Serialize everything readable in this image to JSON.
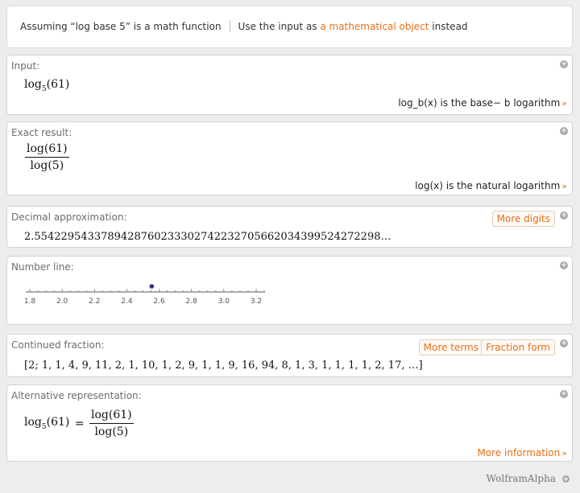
{
  "assumption": {
    "prefix": "Assuming “log base 5” is a math function",
    "alt_prefix": "Use the input as ",
    "alt_link": "a mathematical object",
    "alt_suffix": " instead"
  },
  "pods": {
    "input": {
      "title": "Input:",
      "expr_fn": "log",
      "expr_sub": "5",
      "expr_arg": "(61)",
      "note": "log_b(x) is the base− b logarithm",
      "note_arrow": "»"
    },
    "exact": {
      "title": "Exact result:",
      "numerator": "log(61)",
      "denominator": "log(5)",
      "note": "log(x) is the natural logarithm",
      "note_arrow": "»"
    },
    "decimal": {
      "title": "Decimal approximation:",
      "button": "More digits",
      "value": "2.5542295433789428760233302742232705662034399524272298…"
    },
    "numberline": {
      "title": "Number line:",
      "ticks": [
        "1.8",
        "2.0",
        "2.2",
        "2.4",
        "2.6",
        "2.8",
        "3.0",
        "3.2"
      ],
      "point_value": 2.554,
      "axis_min": 1.8,
      "axis_max": 3.2,
      "point_color": "#2e3192"
    },
    "continued": {
      "title": "Continued fraction:",
      "button_terms": "More terms",
      "button_fraction": "Fraction form",
      "value": "[2; 1, 1, 4, 9, 11, 2, 1, 10, 1, 2, 9, 1, 1, 9, 16, 94, 8, 1, 3, 1, 1, 1, 1, 2, 17, …]"
    },
    "alternative": {
      "title": "Alternative representation:",
      "lhs_fn": "log",
      "lhs_sub": "5",
      "lhs_arg": "(61)",
      "equals": "=",
      "numerator": "log(61)",
      "denominator": "log(5)",
      "more_info": "More information",
      "more_info_arrow": "»"
    }
  },
  "footer": {
    "brand": "WolframAlpha"
  },
  "colors": {
    "accent": "#e8701a",
    "background": "#ededed"
  }
}
